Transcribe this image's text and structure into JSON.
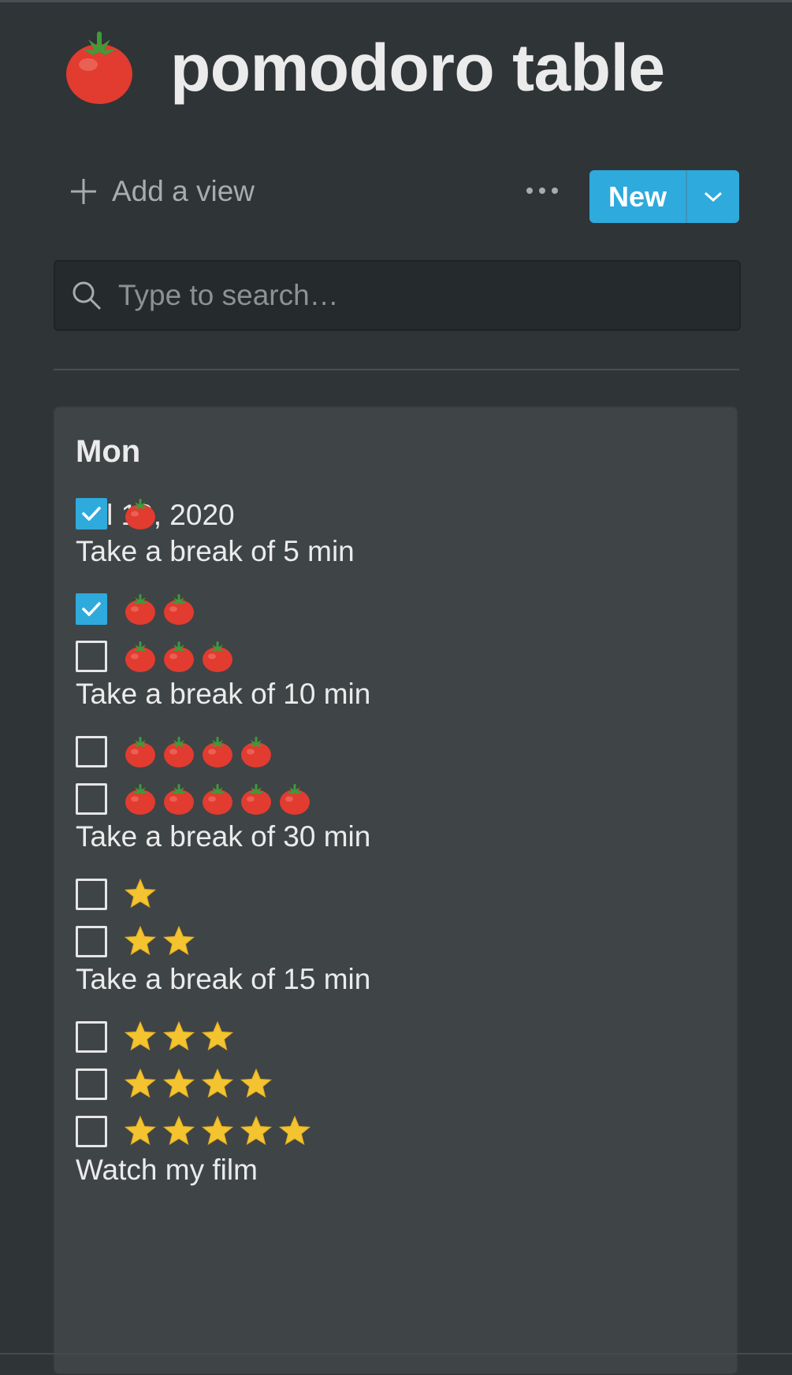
{
  "page": {
    "icon": "tomato-icon",
    "title": "pomodoro table"
  },
  "toolbar": {
    "add_view_label": "Add a view",
    "more_icon": "ellipsis-icon",
    "new_label": "New",
    "new_dropdown_icon": "chevron-down-icon"
  },
  "search": {
    "placeholder": "Type to search…",
    "value": ""
  },
  "colors": {
    "background": "#2f3437",
    "card": "#3f4447",
    "accent": "#2eaadc",
    "tomato": "#e23b2f",
    "star": "#f3c430"
  },
  "card": {
    "heading": "Mon",
    "date": "Jul 19, 2020",
    "rows": [
      {
        "kind": "todo",
        "checked": true,
        "icon": "tomato-icon",
        "count": 1
      },
      {
        "kind": "text",
        "text": "Take a break of 5 min"
      },
      {
        "kind": "todo",
        "checked": true,
        "icon": "tomato-icon",
        "count": 2
      },
      {
        "kind": "todo",
        "checked": false,
        "icon": "tomato-icon",
        "count": 3
      },
      {
        "kind": "text",
        "text": "Take a break of 10 min"
      },
      {
        "kind": "todo",
        "checked": false,
        "icon": "tomato-icon",
        "count": 4
      },
      {
        "kind": "todo",
        "checked": false,
        "icon": "tomato-icon",
        "count": 5
      },
      {
        "kind": "text",
        "text": "Take a break of 30 min"
      },
      {
        "kind": "todo",
        "checked": false,
        "icon": "star-icon",
        "count": 1
      },
      {
        "kind": "todo",
        "checked": false,
        "icon": "star-icon",
        "count": 2
      },
      {
        "kind": "text",
        "text": "Take a break of 15 min"
      },
      {
        "kind": "todo",
        "checked": false,
        "icon": "star-icon",
        "count": 3
      },
      {
        "kind": "todo",
        "checked": false,
        "icon": "star-icon",
        "count": 4
      },
      {
        "kind": "todo",
        "checked": false,
        "icon": "star-icon",
        "count": 5
      },
      {
        "kind": "text",
        "text": "Watch my film"
      }
    ]
  }
}
